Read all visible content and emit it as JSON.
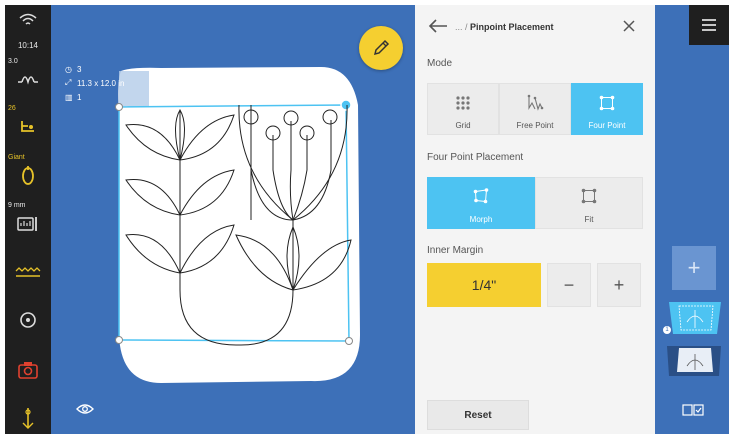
{
  "status": {
    "time": "10:14",
    "wifi_icon": "wifi-icon"
  },
  "left_bar": {
    "tension": {
      "value": "3.0",
      "icon": "tension-icon"
    },
    "speed": {
      "value": "26",
      "icon": "stitch-regulator-icon"
    },
    "hopper": {
      "value": "Giant",
      "icon": "foot-icon"
    },
    "stitch_length": {
      "value": "9 mm",
      "icon": "stitch-length-icon"
    },
    "items": [
      {
        "icon": "zigzag-stitch-icon"
      },
      {
        "icon": "bobbin-icon"
      },
      {
        "icon": "camera-icon"
      },
      {
        "icon": "needle-icon"
      }
    ]
  },
  "canvas": {
    "stats": {
      "repeat_count": "3",
      "size": "11.3 x 12.0 in",
      "rows": "1"
    },
    "edit_icon": "pencil-icon",
    "eye_icon": "eye-icon"
  },
  "panel": {
    "breadcrumb_prefix": "... /",
    "title": "Pinpoint Placement",
    "mode": {
      "label": "Mode",
      "options": [
        {
          "label": "Grid",
          "icon": "grid-dots-icon",
          "active": false
        },
        {
          "label": "Free Point",
          "icon": "free-point-icon",
          "active": false
        },
        {
          "label": "Four Point",
          "icon": "four-point-icon",
          "active": true
        }
      ]
    },
    "four_point_placement": {
      "label": "Four Point Placement",
      "options": [
        {
          "label": "Morph",
          "icon": "morph-icon",
          "active": true
        },
        {
          "label": "Fit",
          "icon": "fit-icon",
          "active": false
        }
      ]
    },
    "inner_margin": {
      "label": "Inner Margin",
      "value": "1/4\"",
      "minus": "−",
      "plus": "+"
    },
    "reset_label": "Reset"
  },
  "right_strip": {
    "menu_icon": "hamburger-menu-icon",
    "add_label": "+",
    "thumb_badge": "1",
    "compare_icon": "compare-icon"
  },
  "colors": {
    "canvas_blue": "#3d70b8",
    "accent_cyan": "#4dc3f2",
    "accent_yellow": "#f5cf30",
    "sidebar_dark": "#1f1f1f"
  }
}
